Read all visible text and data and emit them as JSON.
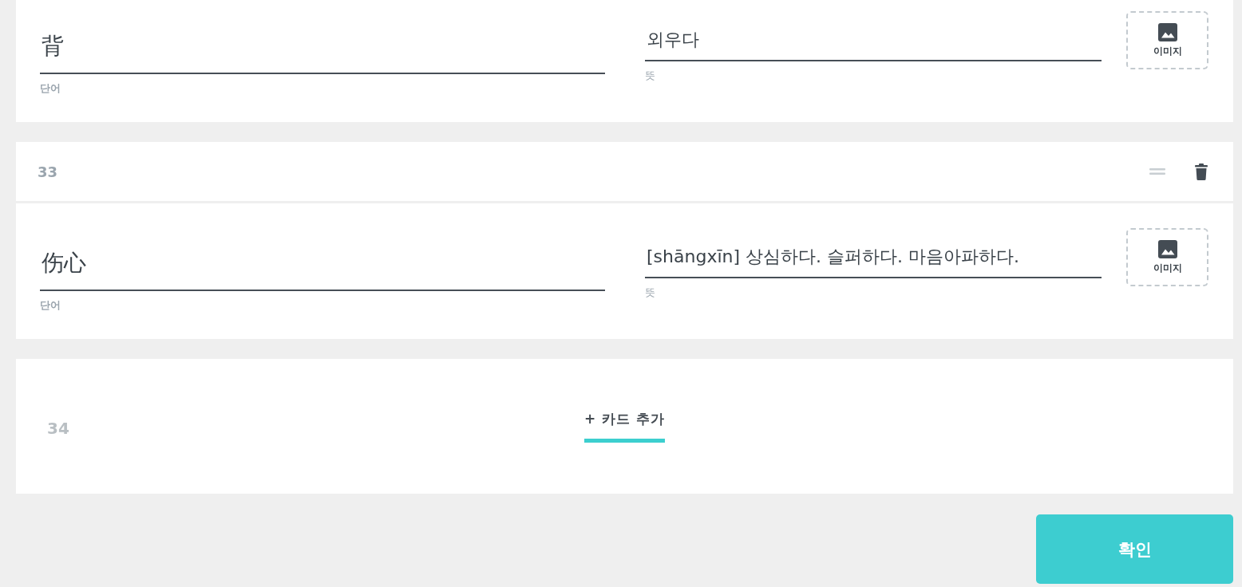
{
  "cards": [
    {
      "term": {
        "value": "背",
        "label": "단어"
      },
      "definition": {
        "value": "외우다",
        "label": "뜻"
      },
      "image_button": "이미지"
    },
    {
      "number": "33",
      "term": {
        "value": "伤心",
        "label": "단어"
      },
      "definition": {
        "value": "[shāngxīn] 상심하다. 슬퍼하다. 마음아파하다.",
        "label": "뜻"
      },
      "image_button": "이미지"
    }
  ],
  "add_card": {
    "number": "34",
    "label": "+ 카드 추가"
  },
  "confirm_button": "확인"
}
